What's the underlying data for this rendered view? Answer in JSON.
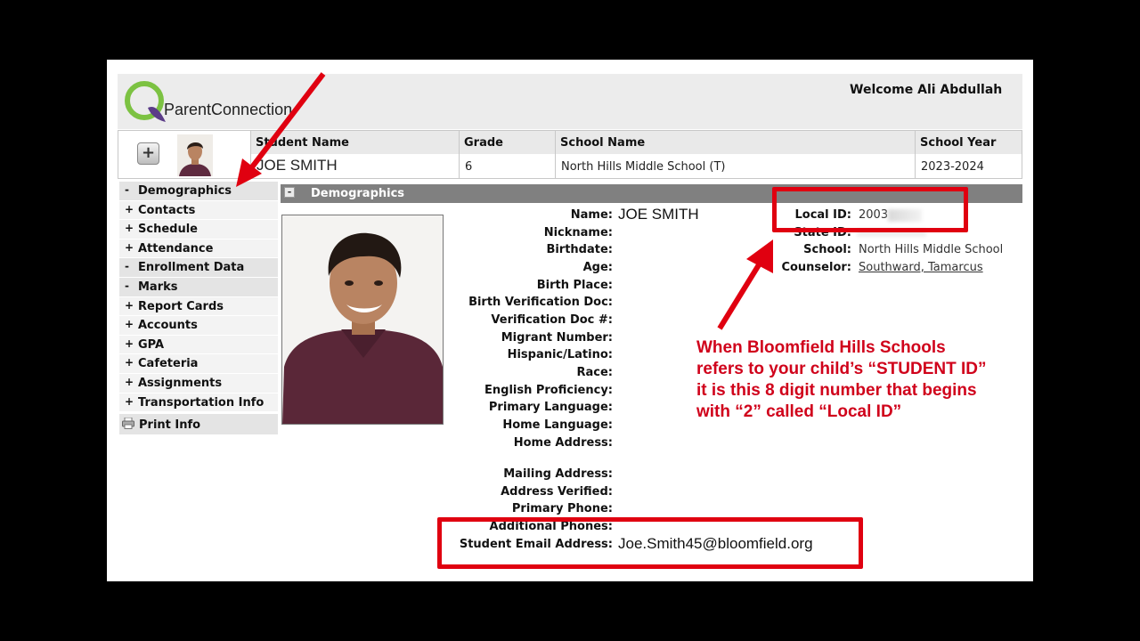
{
  "app": {
    "logo_text": "ParentConnection",
    "welcome": "Welcome Ali Abdullah"
  },
  "student_bar": {
    "headers": [
      "Student Name",
      "Grade",
      "School Name",
      "School Year"
    ],
    "values": [
      "JOE SMITH",
      "6",
      "North Hills Middle School (T)",
      "2023-2024"
    ],
    "plus_label": "+"
  },
  "sidebar": {
    "items": [
      {
        "sign": "-",
        "label": "Demographics"
      },
      {
        "sign": "+",
        "label": "Contacts"
      },
      {
        "sign": "+",
        "label": "Schedule"
      },
      {
        "sign": "+",
        "label": "Attendance"
      },
      {
        "sign": "-",
        "label": "Enrollment Data"
      },
      {
        "sign": "-",
        "label": "Marks"
      },
      {
        "sign": "+",
        "label": "Report Cards"
      },
      {
        "sign": "+",
        "label": "Accounts"
      },
      {
        "sign": "+",
        "label": "GPA"
      },
      {
        "sign": "+",
        "label": "Cafeteria"
      },
      {
        "sign": "+",
        "label": "Assignments"
      },
      {
        "sign": "+",
        "label": "Transportation Info"
      }
    ],
    "print_label": "Print Info"
  },
  "demographics": {
    "title": "Demographics",
    "collapse_sign": "-",
    "fields": [
      {
        "label": "Name:",
        "value": "JOE SMITH"
      },
      {
        "label": "Nickname:",
        "value": ""
      },
      {
        "label": "Birthdate:",
        "value": ""
      },
      {
        "label": "Age:",
        "value": ""
      },
      {
        "label": "Birth Place:",
        "value": ""
      },
      {
        "label": "Birth Verification Doc:",
        "value": ""
      },
      {
        "label": "Verification Doc #:",
        "value": ""
      },
      {
        "label": "Migrant Number:",
        "value": ""
      },
      {
        "label": "Hispanic/Latino:",
        "value": ""
      },
      {
        "label": "Race:",
        "value": ""
      },
      {
        "label": "English Proficiency:",
        "value": ""
      },
      {
        "label": "Primary Language:",
        "value": ""
      },
      {
        "label": "Home Language:",
        "value": ""
      },
      {
        "label": "Home Address:",
        "value": ""
      },
      {
        "label": "Mailing Address:",
        "value": ""
      },
      {
        "label": "Address Verified:",
        "value": ""
      },
      {
        "label": "Primary Phone:",
        "value": ""
      },
      {
        "label": "Additional Phones:",
        "value": ""
      },
      {
        "label": "Student Email Address:",
        "value": "Joe.Smith45@bloomfield.org"
      }
    ],
    "right_fields": [
      {
        "label": "Local ID:",
        "value": "2003"
      },
      {
        "label": "State ID:",
        "value": ""
      },
      {
        "label": "School:",
        "value": "North Hills Middle School"
      },
      {
        "label": "Counselor:",
        "value": "Southward, Tamarcus"
      }
    ]
  },
  "annotation": {
    "note": "When Bloomfield Hills Schools refers to your child’s “STUDENT ID” it is this 8 digit number that begins with “2” called “Local ID”",
    "color": "#d0021b"
  }
}
